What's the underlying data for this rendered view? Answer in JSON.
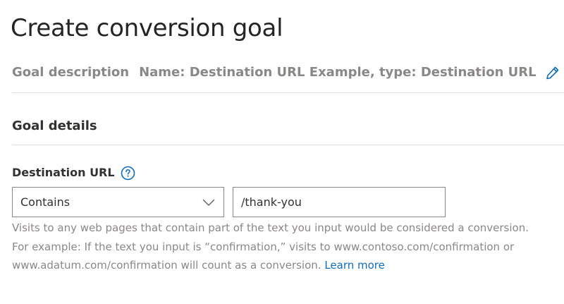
{
  "page": {
    "title": "Create conversion goal"
  },
  "goal_description": {
    "label": "Goal description",
    "value": "Name: Destination URL Example, type: Destination URL",
    "edit_icon": "pencil-icon"
  },
  "goal_details": {
    "title": "Goal details"
  },
  "destination_url": {
    "label": "Destination URL",
    "help_icon": "question-circle-icon",
    "operator": {
      "selected": "Contains"
    },
    "input": {
      "value": "/thank-you"
    },
    "helper_text": "Visits to any web pages that contain part of the text you input would be considered a conversion. For example: If the text you input is “confirmation,” visits to www.contoso.com/confirmation or www.adatum.com/confirmation will count as a conversion.",
    "learn_more": "Learn more"
  },
  "colors": {
    "accent": "#0f6cbd",
    "muted_text": "#8a8886",
    "border": "#8a8886",
    "divider": "#e1dfdd"
  }
}
